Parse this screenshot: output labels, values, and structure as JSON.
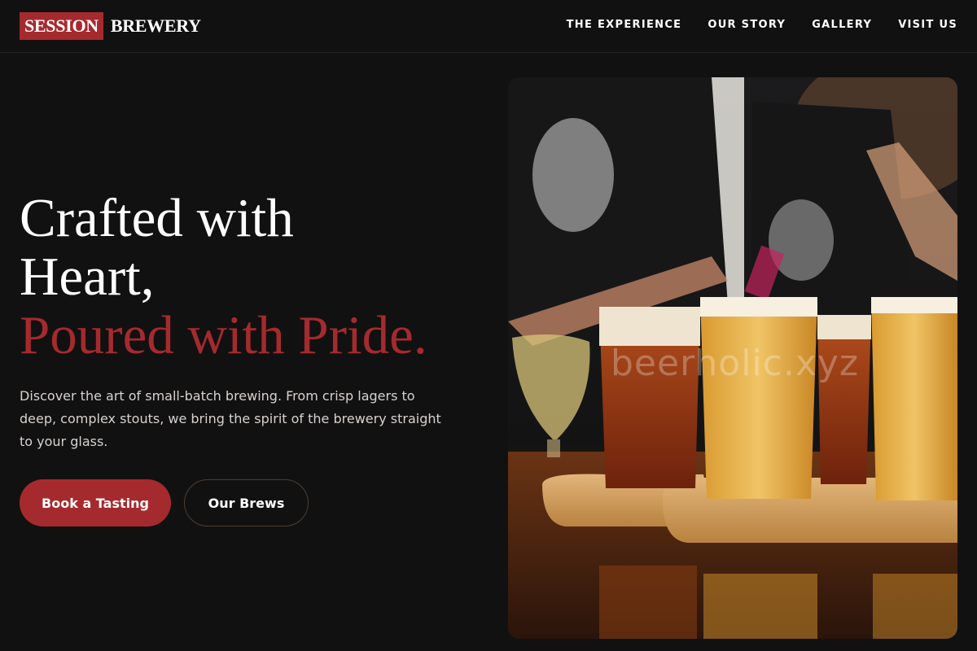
{
  "brand": {
    "box_text": "SESSION",
    "text": "BREWERY",
    "accent_color": "#a52a2e"
  },
  "nav": {
    "items": [
      {
        "label": "THE EXPERIENCE"
      },
      {
        "label": "OUR STORY"
      },
      {
        "label": "GALLERY"
      },
      {
        "label": "VISIT US"
      }
    ]
  },
  "hero": {
    "title_line1": "Crafted with",
    "title_line2": "Heart,",
    "title_accent": "Poured with Pride.",
    "description": "Discover the art of small-batch brewing. From crisp lagers to deep, complex stouts, we bring the spirit of the brewery straight to your glass.",
    "primary_button": "Book a Tasting",
    "secondary_button": "Our Brews"
  },
  "image": {
    "watermark": "beerholic.xyz",
    "subject": "beer-flight-photo"
  }
}
